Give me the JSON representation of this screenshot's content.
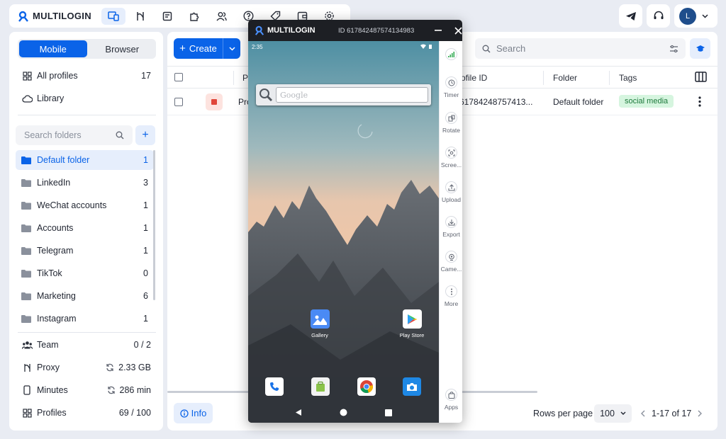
{
  "app": {
    "name": "MULTILOGIN"
  },
  "topnav": {
    "icons": [
      "devices-icon",
      "automation-icon",
      "clipboard-icon",
      "puzzle-icon",
      "team-icon",
      "help-icon",
      "tag-icon",
      "wallet-icon",
      "settings-icon"
    ],
    "right_icons": [
      "telegram-icon",
      "support-icon"
    ],
    "user_initial": "L"
  },
  "sidebar": {
    "tabs": [
      "Mobile",
      "Browser"
    ],
    "active_tab": "Mobile",
    "all_profiles": {
      "label": "All profiles",
      "count": "17"
    },
    "library": {
      "label": "Library"
    },
    "search_placeholder": "Search folders",
    "folders": [
      {
        "label": "Default folder",
        "count": "1",
        "selected": true
      },
      {
        "label": "LinkedIn",
        "count": "3"
      },
      {
        "label": "WeChat accounts",
        "count": "1"
      },
      {
        "label": "Accounts",
        "count": "1"
      },
      {
        "label": "Telegram",
        "count": "1"
      },
      {
        "label": "TikTok",
        "count": "0"
      },
      {
        "label": "Marketing",
        "count": "6"
      },
      {
        "label": "Instagram",
        "count": "1"
      }
    ],
    "usage": [
      {
        "label": "Team",
        "value": "0 / 2"
      },
      {
        "label": "Proxy",
        "value": "2.33 GB"
      },
      {
        "label": "Minutes",
        "value": "286 min"
      },
      {
        "label": "Profiles",
        "value": "69 / 100"
      }
    ]
  },
  "main": {
    "create_label": "Create",
    "search_placeholder": "Search",
    "columns": [
      "Pr",
      "ofile ID",
      "Folder",
      "Tags"
    ],
    "rows": [
      {
        "name": "Pro",
        "profile_id": "61784248757413...",
        "folder": "Default folder",
        "tag": "social media"
      }
    ],
    "info_label": "Info",
    "rows_per_page_label": "Rows per page",
    "rows_per_page_value": "100",
    "page_range": "1-17 of 17"
  },
  "phone": {
    "title": "MULTILOGIN",
    "id_text": "ID 617842487574134983",
    "status_time": "2:35",
    "search_placeholder": "Google",
    "apps": [
      {
        "label": "Gallery"
      },
      {
        "label": "Play Store"
      }
    ],
    "tools": [
      "Timer",
      "Rotate",
      "Scree...",
      "Upload",
      "Export",
      "Came...",
      "More",
      "Apps"
    ]
  }
}
